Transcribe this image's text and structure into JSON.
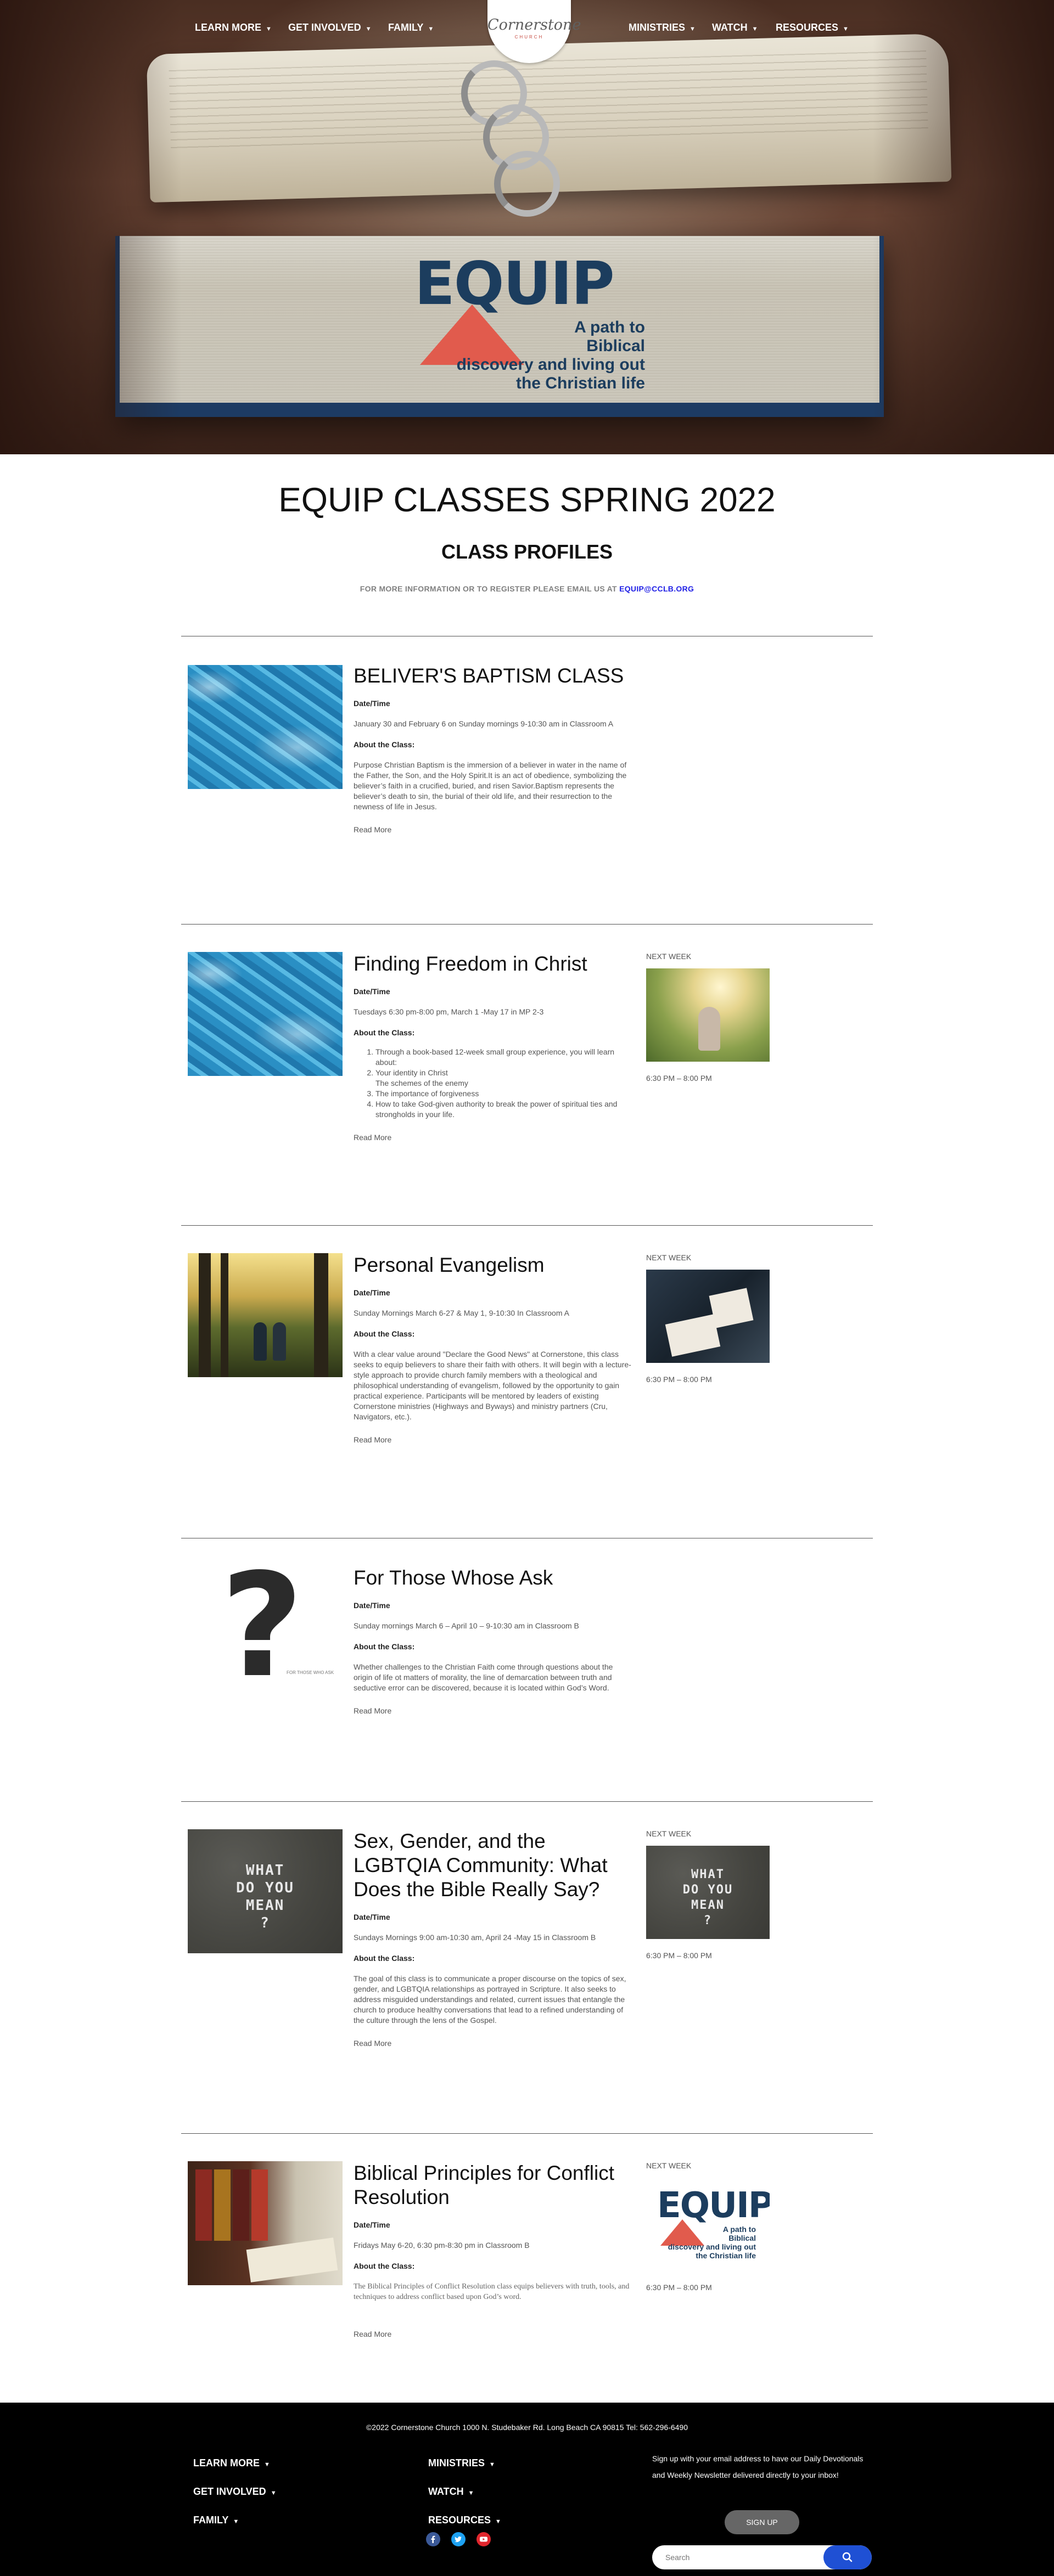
{
  "nav": {
    "left": [
      {
        "label": "LEARN MORE"
      },
      {
        "label": "GET INVOLVED"
      },
      {
        "label": "FAMILY"
      }
    ],
    "right": [
      {
        "label": "MINISTRIES"
      },
      {
        "label": "WATCH"
      },
      {
        "label": "RESOURCES"
      }
    ],
    "caret": "▼",
    "logo": {
      "script": "Cornerstone",
      "sub": "CHURCH"
    }
  },
  "hero": {
    "logo_word": "EQUIP",
    "tagline": [
      "A path to",
      "Biblical",
      "discovery and living out",
      "the Christian life"
    ],
    "colors": {
      "navy": "#1c3d5e",
      "coral": "#e15b4d"
    }
  },
  "header": {
    "title": "EQUIP CLASSES SPRING 2022",
    "subtitle": "CLASS PROFILES",
    "email_prefix": "FOR MORE INFORMATION OR TO REGISTER PLEASE EMAIL US AT",
    "email_link": "EQUIP@CCLB.ORG"
  },
  "labels": {
    "datetime": "Date/Time",
    "about": "About the Class:",
    "read_more": "Read More",
    "next_week": "NEXT WEEK"
  },
  "classes": [
    {
      "title": "BELIVER'S BAPTISM CLASS",
      "datetime": "January 30 and February 6 on Sunday mornings 9-10:30 am in Classroom A",
      "about": "Purpose Christian Baptism is the immersion of a believer in water in the name of the Father, the Son, and the Holy Spirit.It is an act of obedience, symbolizing the believer’s faith in a crucified, buried, and risen Savior.Baptism represents the believer’s death to sin, the burial of their old life, and their resurrection to the newness of life in Jesus.",
      "image": "pool-water-image"
    },
    {
      "title": "Finding Freedom in Christ",
      "datetime": "Tuesdays 6:30 pm-8:00 pm, March 1 -May 17 in MP 2-3",
      "points": [
        "Through a book-based 12-week small group experience, you will learn about:",
        "Your identity in Christ\nThe schemes of the enemy",
        "The importance of forgiveness",
        "How to take God-given authority to break the power of spiritual ties and strongholds in your life."
      ],
      "next_week_time": "6:30 PM – 8:00 PM",
      "image": "pool-water-image"
    },
    {
      "title": "Personal Evangelism",
      "datetime": "Sunday Mornings March 6-27 & May 1, 9-10:30 In Classroom A",
      "about": "With a clear value around \"Declare the Good News\" at Cornerstone, this class seeks to equip believers to share their faith with others. It will begin with a lecture-style approach to provide church family members with a theological and philosophical understanding of evangelism, followed by the opportunity to gain practical experience. Participants will be mentored by leaders of existing Cornerstone ministries (Highways and Byways) and ministry partners (Cru, Navigators, etc.).",
      "next_week_time": "6:30 PM – 8:00 PM",
      "image": "forest-path-image"
    },
    {
      "title": "For Those Whose Ask",
      "datetime": "Sunday mornings March 6 – April 10 – 9-10:30 am in Classroom B",
      "about": "Whether challenges to the Christian Faith come through questions about the origin of life ot matters of morality, the line of demarcation between truth and seductive error can be discovered, because it is located within God’s Word.",
      "image": "question-mark-image",
      "image_caption": "FOR THOSE WHO ASK"
    },
    {
      "title": "Sex, Gender, and the LGBTQIA Community: What Does the Bible Really Say?",
      "datetime": "Sundays Mornings 9:00 am-10:30 am, April 24 -May 15 in Classroom B",
      "about": "The goal of this class is to communicate a proper discourse on the topics of sex, gender, and LGBTQIA relationships as portrayed in Scripture. It also seeks to address misguided understandings and related, current issues that entangle the church to produce healthy conversations that lead to a refined understanding of the culture through the lens of the Gospel.",
      "next_week_time": "6:30 PM – 8:00 PM",
      "image": "chalk-pavement-image",
      "chalk": [
        "WHAT",
        "DO YOU",
        "MEAN",
        "?"
      ]
    },
    {
      "title": "Biblical Principles for Conflict Resolution",
      "datetime": "Fridays May 6-20, 6:30 pm-8:30 pm in Classroom B",
      "about": "The Biblical Principles of Conflict Resolution class equips believers with truth, tools, and techniques to address conflict based upon God’s word.",
      "next_week_time": "6:30 PM – 8:00 PM",
      "image": "books-image"
    }
  ],
  "footer": {
    "copyright": "©2022 Cornerstone Church 1000 N. Studebaker Rd. Long Beach CA 90815 Tel: 562-296-6490",
    "nav_left": [
      {
        "label": "LEARN MORE"
      },
      {
        "label": "GET INVOLVED"
      },
      {
        "label": "FAMILY"
      }
    ],
    "nav_right": [
      {
        "label": "MINISTRIES"
      },
      {
        "label": "WATCH"
      },
      {
        "label": "RESOURCES"
      }
    ],
    "signup_text": "Sign up with your email address to have our Daily Devotionals and Weekly Newsletter delivered directly to your inbox!",
    "signup_button": "SIGN UP",
    "search_placeholder": "Search",
    "social": [
      {
        "icon": "facebook-icon",
        "color": "#3b5998"
      },
      {
        "icon": "twitter-icon",
        "color": "#1da1f2"
      },
      {
        "icon": "youtube-icon",
        "color": "#e0262d"
      }
    ]
  }
}
